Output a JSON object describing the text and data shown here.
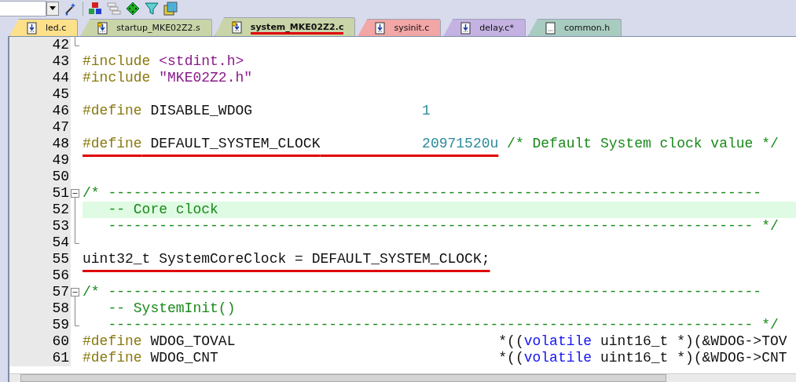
{
  "tabs": [
    {
      "label": "led.c",
      "color": "#fde08a",
      "selected": false,
      "kind": "file"
    },
    {
      "label": "startup_MKE02Z2.s",
      "color": "#c9d5a9",
      "selected": false,
      "kind": "locked"
    },
    {
      "label": "system_MKE02Z2.c",
      "color": "#c9d5a9",
      "selected": true,
      "kind": "locked",
      "marked": true
    },
    {
      "label": "sysinit.c",
      "color": "#f2a6a6",
      "selected": false,
      "kind": "file"
    },
    {
      "label": "delay.c*",
      "color": "#c4b2e2",
      "selected": false,
      "kind": "file"
    },
    {
      "label": "common.h",
      "color": "#a9ccc0",
      "selected": false,
      "kind": "blank"
    }
  ],
  "lines": [
    {
      "number": "42",
      "kind": "end"
    },
    {
      "number": "43",
      "tokens": [
        {
          "text": "#include",
          "kind": "keyword"
        },
        {
          "text": " <stdint.h>",
          "kind": "string"
        }
      ]
    },
    {
      "number": "44",
      "tokens": [
        {
          "text": "#include",
          "kind": "keyword"
        },
        {
          "text": " \"MKE02Z2.h\"",
          "kind": "string"
        }
      ]
    },
    {
      "number": "45"
    },
    {
      "number": "46",
      "tokens": [
        {
          "text": "#define",
          "kind": "keyword"
        },
        {
          "text": " DISABLE_WDOG",
          "kind": "plain"
        },
        {
          "text": "                    1",
          "kind": "number"
        }
      ]
    },
    {
      "number": "47"
    },
    {
      "number": "48",
      "tokens": [
        {
          "text": "#define",
          "kind": "keyword",
          "marked": true
        },
        {
          "text": " DEFAULT_SYSTEM_CLOCK",
          "kind": "plain",
          "marked": true
        },
        {
          "text": "            20971520u",
          "kind": "number",
          "marked": true
        },
        {
          "text": " /* Default System clock value */",
          "kind": "comment"
        }
      ]
    },
    {
      "number": "49"
    },
    {
      "number": "50"
    },
    {
      "number": "51",
      "kind": "start",
      "tokens": [
        {
          "text": "/* -----------------------------------------------------------------------------",
          "kind": "comment"
        }
      ]
    },
    {
      "number": "52",
      "kind": "middle",
      "highlighted": true,
      "tokens": [
        {
          "text": "   -- Core clock",
          "kind": "comment"
        }
      ]
    },
    {
      "number": "53",
      "kind": "middle",
      "tokens": [
        {
          "text": "   ---------------------------------------------------------------------------- */",
          "kind": "comment"
        }
      ]
    },
    {
      "number": "54",
      "kind": "end"
    },
    {
      "number": "55",
      "tokens": [
        {
          "text": "uint32_t SystemCoreClock = DEFAULT_SYSTEM_CLOCK;",
          "kind": "plain",
          "marked": true
        }
      ]
    },
    {
      "number": "56"
    },
    {
      "number": "57",
      "kind": "start",
      "tokens": [
        {
          "text": "/* -----------------------------------------------------------------------------",
          "kind": "comment"
        }
      ]
    },
    {
      "number": "58",
      "kind": "middle",
      "tokens": [
        {
          "text": "   -- SystemInit()",
          "kind": "comment"
        }
      ]
    },
    {
      "number": "59",
      "kind": "end",
      "tokens": [
        {
          "text": "   ---------------------------------------------------------------------------- */",
          "kind": "comment"
        }
      ]
    },
    {
      "number": "60",
      "tokens": [
        {
          "text": "#define",
          "kind": "keyword"
        },
        {
          "text": " WDOG_TOVAL                               *((",
          "kind": "plain"
        },
        {
          "text": "volatile",
          "kind": "type"
        },
        {
          "text": " uint16_t *)(&WDOG->TOV",
          "kind": "plain"
        }
      ]
    },
    {
      "number": "61",
      "tokens": [
        {
          "text": "#define",
          "kind": "keyword"
        },
        {
          "text": " WDOG_CNT                                 *((",
          "kind": "plain"
        },
        {
          "text": "volatile",
          "kind": "type"
        },
        {
          "text": " uint16_t *)(&WDOG->CNT",
          "kind": "plain"
        }
      ]
    }
  ]
}
